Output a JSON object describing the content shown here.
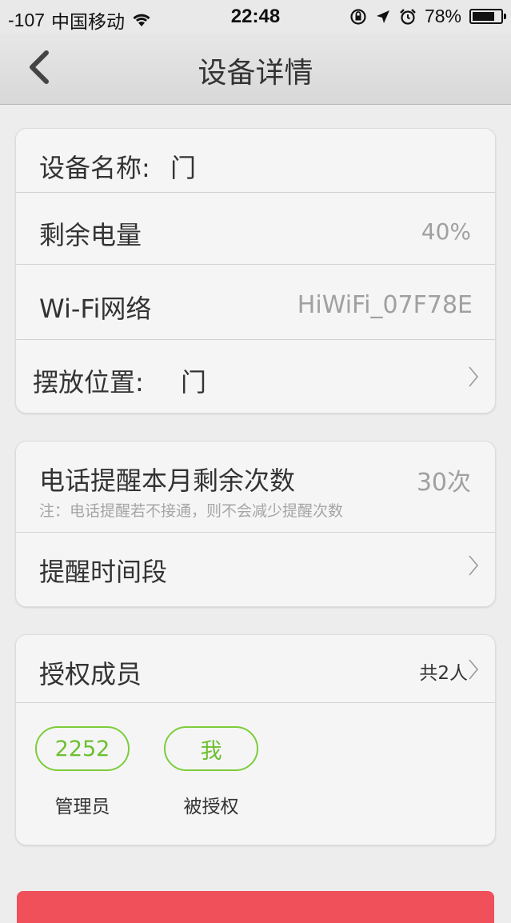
{
  "status_bar": {
    "signal": "-107",
    "carrier": "中国移动",
    "time": "22:48",
    "battery_percent": "78%",
    "battery_level": 0.78
  },
  "nav": {
    "title": "设备详情"
  },
  "device_card": {
    "name_label": "设备名称:",
    "name_value": "门",
    "battery_label": "剩余电量",
    "battery_value": "40%",
    "wifi_label": "Wi-Fi网络",
    "wifi_value": "HiWiFi_07F78E",
    "location_label": "摆放位置:",
    "location_value": "门"
  },
  "reminder_card": {
    "calls_label": "电话提醒本月剩余次数",
    "calls_value": "30次",
    "calls_note": "注：电话提醒若不接通，则不会减少提醒次数",
    "period_label": "提醒时间段"
  },
  "members_card": {
    "title": "授权成员",
    "count": "共2人",
    "members": [
      {
        "name": "2252",
        "role": "管理员"
      },
      {
        "name": "我",
        "role": "被授权"
      }
    ]
  },
  "colors": {
    "accent_green": "#7ccd3a",
    "danger_red": "#f0505a"
  }
}
